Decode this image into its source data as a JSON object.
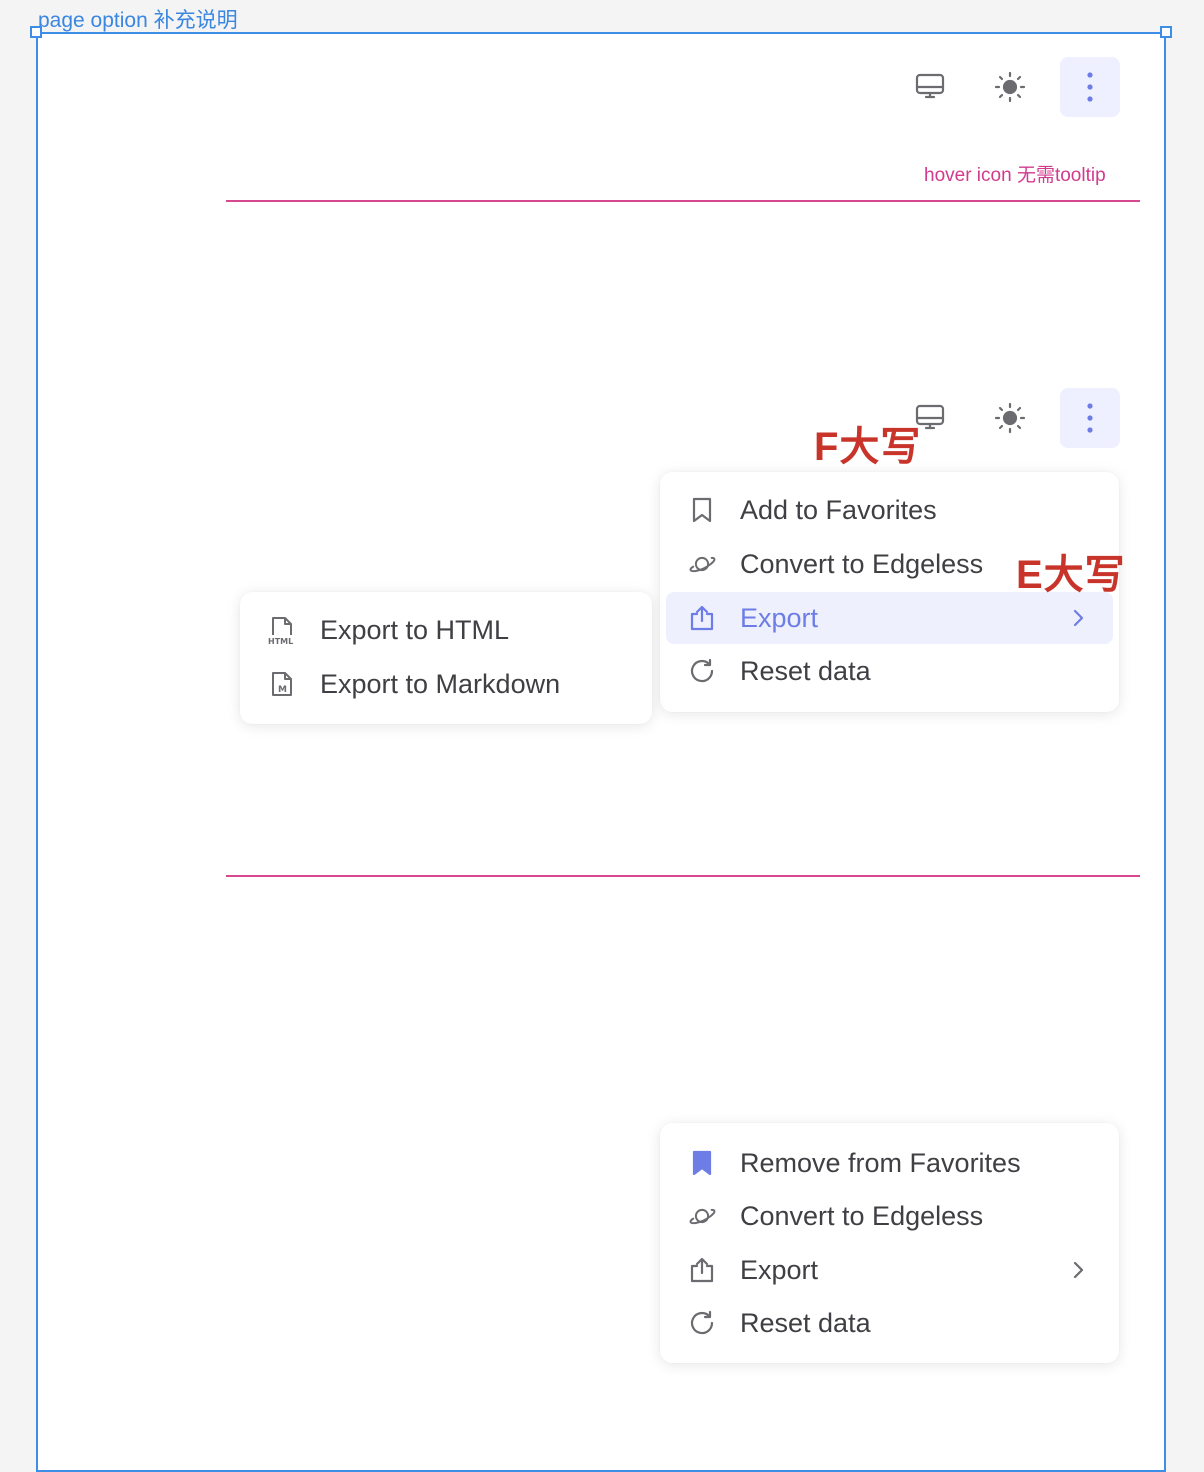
{
  "frame": {
    "label": "page option 补充说明"
  },
  "notes": {
    "hover_note": "hover icon 无需tooltip",
    "f_note": "F大写",
    "e_note": "E大写"
  },
  "header": {
    "icons": [
      "monitor-icon",
      "sun-icon",
      "more-vertical-icon"
    ],
    "active_icon": "more-vertical-icon"
  },
  "menu_default": {
    "items": [
      {
        "icon": "bookmark-icon",
        "label": "Add to Favorites"
      },
      {
        "icon": "planet-icon",
        "label": "Convert to Edgeless"
      },
      {
        "icon": "export-icon",
        "label": "Export",
        "hovered": true,
        "has_submenu": true
      },
      {
        "icon": "reset-icon",
        "label": "Reset data"
      }
    ]
  },
  "submenu_export": {
    "items": [
      {
        "icon": "html-file-icon",
        "label": "Export to HTML"
      },
      {
        "icon": "markdown-file-icon",
        "label": "Export to Markdown"
      }
    ]
  },
  "menu_favorited": {
    "items": [
      {
        "icon": "bookmark-filled-icon",
        "label": "Remove from Favorites"
      },
      {
        "icon": "planet-icon",
        "label": "Convert to Edgeless"
      },
      {
        "icon": "export-icon",
        "label": "Export",
        "has_submenu": true
      },
      {
        "icon": "reset-icon",
        "label": "Reset data"
      }
    ]
  },
  "colors": {
    "accent": "#6e7de6",
    "annotation_pink": "#d23a8d",
    "annotation_red": "#c8342a",
    "frame_blue": "#3d8ee6"
  }
}
